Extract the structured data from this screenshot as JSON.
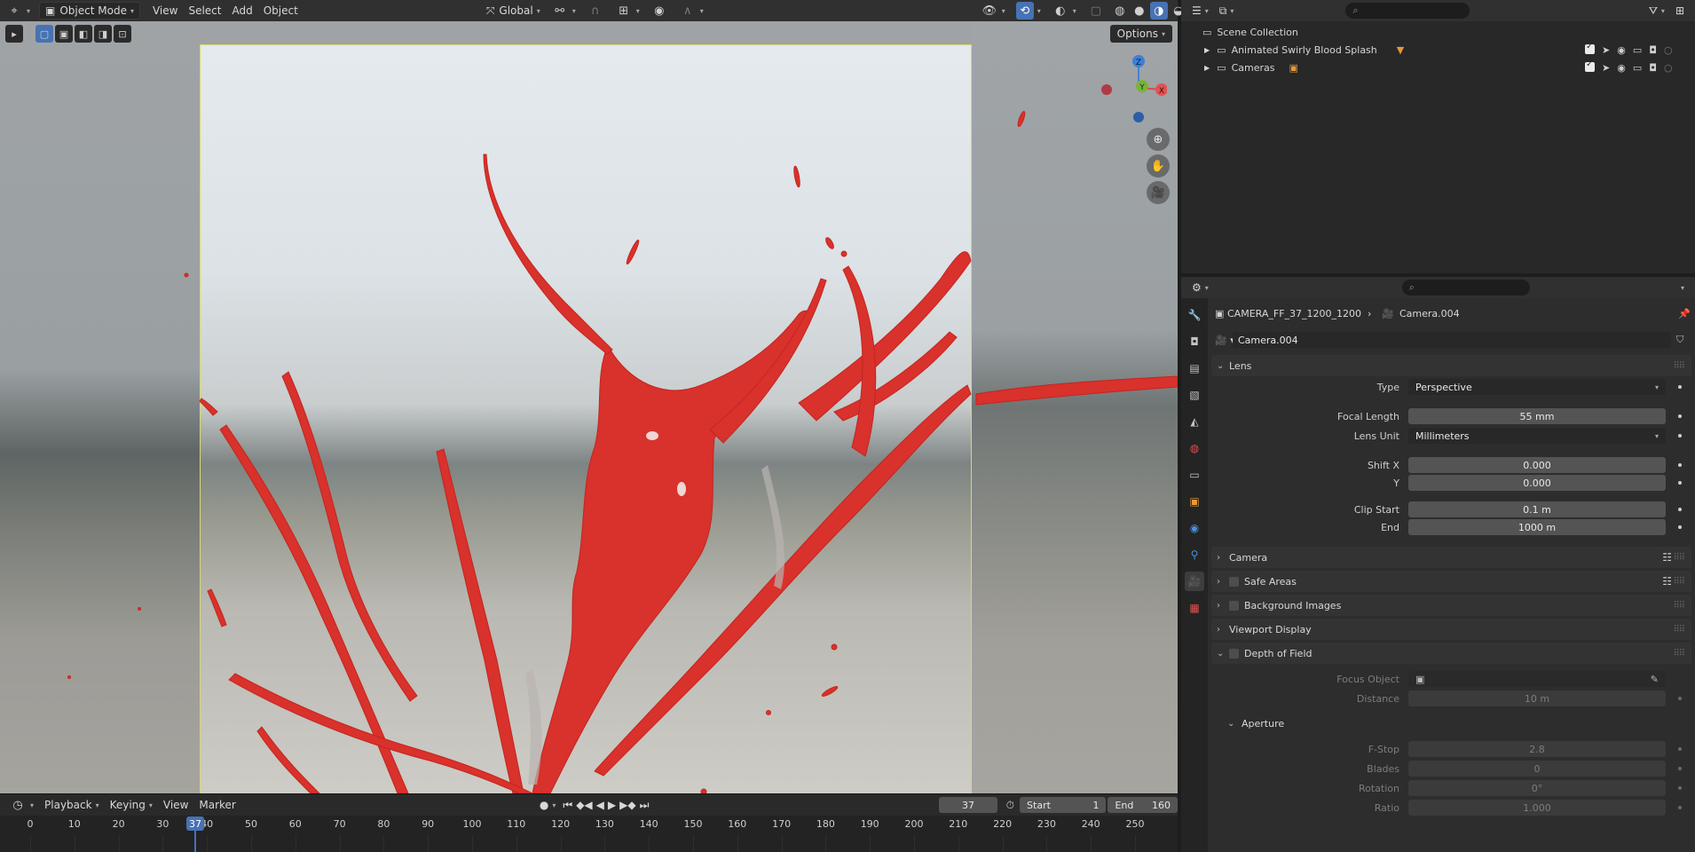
{
  "viewport_header": {
    "mode": "Object Mode",
    "menus": [
      "View",
      "Select",
      "Add",
      "Object"
    ],
    "transform_orientation": "Global",
    "options_label": "Options"
  },
  "gizmo": {
    "z": "Z",
    "x": "X",
    "y": "Y"
  },
  "timeline": {
    "menus": [
      "Playback",
      "Keying",
      "View",
      "Marker"
    ],
    "current_frame": "37",
    "start_label": "Start",
    "start_value": "1",
    "end_label": "End",
    "end_value": "160",
    "ticks": [
      "0",
      "10",
      "20",
      "30",
      "40",
      "50",
      "60",
      "70",
      "80",
      "90",
      "100",
      "110",
      "120",
      "130",
      "140",
      "150",
      "160",
      "170",
      "180",
      "190",
      "200",
      "210",
      "220",
      "230",
      "240",
      "250"
    ],
    "playhead_label": "37"
  },
  "outliner": {
    "root": "Scene Collection",
    "items": [
      {
        "label": "Animated Swirly Blood Splash"
      },
      {
        "label": "Cameras"
      }
    ]
  },
  "properties": {
    "breadcrumb_object": "CAMERA_FF_37_1200_1200",
    "breadcrumb_data": "Camera.004",
    "datablock_name": "Camera.004",
    "panels": {
      "lens": "Lens",
      "camera": "Camera",
      "safe_areas": "Safe Areas",
      "background_images": "Background Images",
      "viewport_display": "Viewport Display",
      "depth_of_field": "Depth of Field",
      "aperture": "Aperture"
    },
    "lens": {
      "type_label": "Type",
      "type_value": "Perspective",
      "focal_label": "Focal Length",
      "focal_value": "55 mm",
      "unit_label": "Lens Unit",
      "unit_value": "Millimeters",
      "shiftx_label": "Shift X",
      "shiftx_value": "0.000",
      "shifty_label": "Y",
      "shifty_value": "0.000",
      "clipstart_label": "Clip Start",
      "clipstart_value": "0.1 m",
      "clipend_label": "End",
      "clipend_value": "1000 m"
    },
    "dof": {
      "focus_label": "Focus Object",
      "distance_label": "Distance",
      "distance_value": "10 m"
    },
    "aperture": {
      "fstop_label": "F-Stop",
      "fstop_value": "2.8",
      "blades_label": "Blades",
      "blades_value": "0",
      "rotation_label": "Rotation",
      "rotation_value": "0°",
      "ratio_label": "Ratio",
      "ratio_value": "1.000"
    }
  },
  "colors": {
    "accent": "#4772b3",
    "splash": "#d9312b",
    "camera_border": "#d8d86a",
    "active_tab": "#3fb9a3"
  }
}
